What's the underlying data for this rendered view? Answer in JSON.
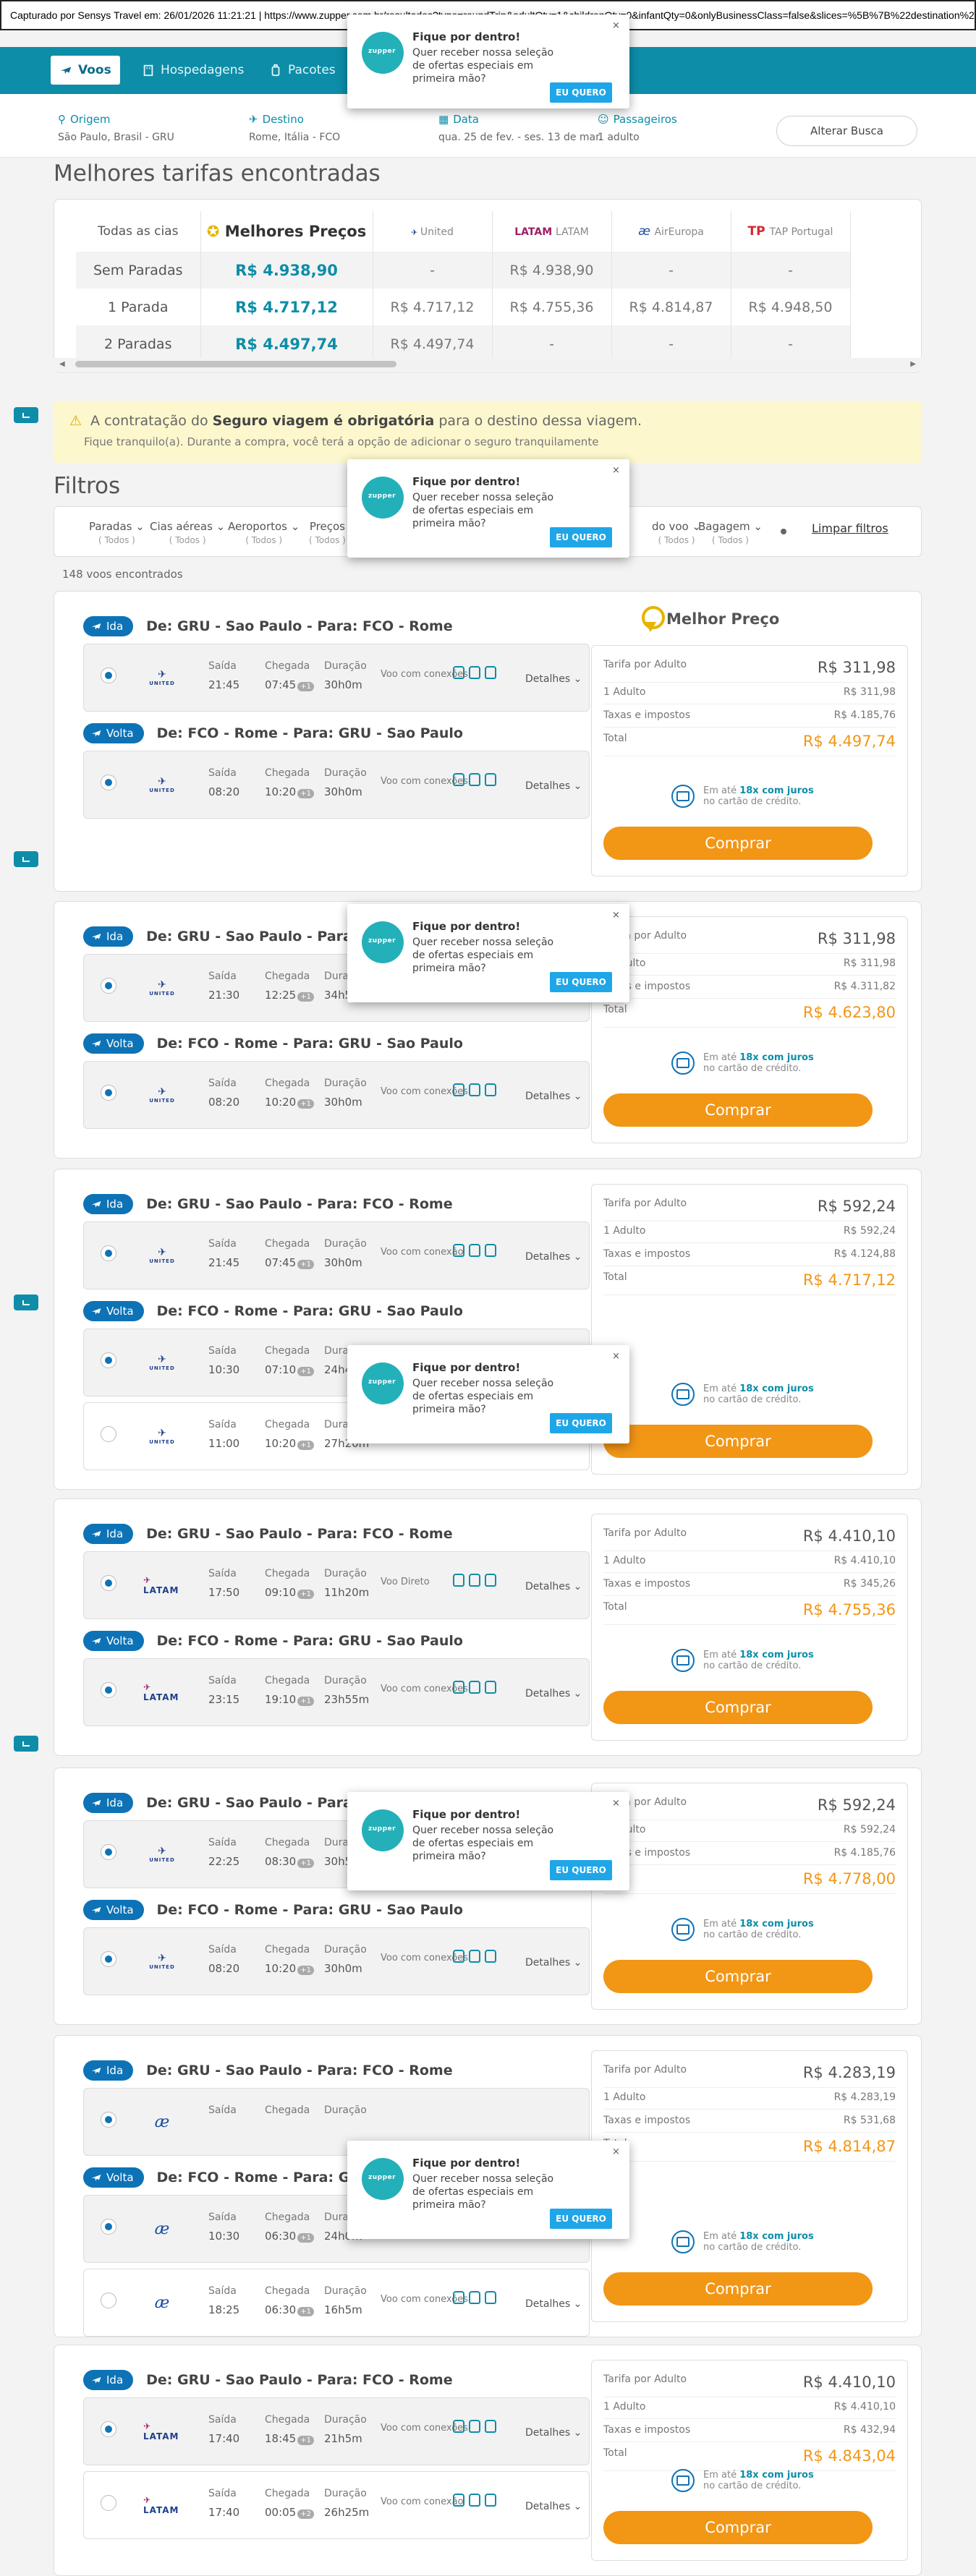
{
  "capture_bar": "Capturado por Sensys Travel em: 26/01/2026 11:21:21  |  https://www.zupper.com.br/resultados?type=roundTrip&adultQty=1&childrenQty=0&infantQty=0&onlyBusinessClass=false&slices=%5B%7B%22destination%22%3A%22FCO%22",
  "nav": {
    "voos": "Voos",
    "hospedagens": "Hospedagens",
    "pacotes": "Pacotes"
  },
  "search": {
    "origem_label": "Origem",
    "origem_value": "São Paulo, Brasil - GRU",
    "destino_label": "Destino",
    "destino_value": "Rome, Itália - FCO",
    "data_label": "Data",
    "data_value": "qua. 25 de fev. - ses. 13 de mar.",
    "pass_label": "Passageiros",
    "pass_value": "1 adulto",
    "alter": "Alterar Busca"
  },
  "fares": {
    "title": "Melhores tarifas encontradas",
    "col_all": "Todas as cias",
    "col_best": "Melhores Preços",
    "airlines": [
      "United",
      "LATAM",
      "AirEuropa",
      "TAP Portugal"
    ],
    "rows": [
      {
        "label": "Sem Paradas",
        "best": "R$ 4.938,90",
        "cells": [
          "-",
          "R$ 4.938,90",
          "-",
          "-"
        ]
      },
      {
        "label": "1 Parada",
        "best": "R$ 4.717,12",
        "cells": [
          "R$ 4.717,12",
          "R$ 4.755,36",
          "R$ 4.814,87",
          "R$ 4.948,50"
        ]
      },
      {
        "label": "2 Paradas",
        "best": "R$ 4.497,74",
        "cells": [
          "R$ 4.497,74",
          "-",
          "-",
          "-"
        ]
      }
    ]
  },
  "warning": {
    "pre": "A contratação do ",
    "bold": "Seguro viagem é obrigatória",
    "post": " para o destino dessa viagem.",
    "sub": "Fique tranquilo(a). Durante a compra, você terá a opção de adicionar o seguro tranquilamente"
  },
  "filters": {
    "title": "Filtros",
    "items": [
      {
        "label": "Paradas",
        "sub": "( Todos )"
      },
      {
        "label": "Cias aéreas",
        "sub": "( Todos )"
      },
      {
        "label": "Aeroportos",
        "sub": "( Todos )"
      },
      {
        "label": "Preços",
        "sub": "( Todos )"
      },
      {
        "label": "do voo",
        "sub": "( Todos )"
      },
      {
        "label": "Bagagem",
        "sub": "( Todos )"
      }
    ],
    "clear": "Limpar filtros",
    "count": "148 voos encontrados"
  },
  "popup": {
    "title": "Fique por dentro!",
    "text": "Quer receber nossa seleção de ofertas especiais em primeira mão?",
    "button": "EU QUERO",
    "close": "×"
  },
  "labels": {
    "ida": "Ida",
    "volta": "Volta",
    "saida": "Saída",
    "chegada": "Chegada",
    "duracao": "Duração",
    "com_conexoes": "Voo com conexões",
    "com_conexao": "Voo com conexão",
    "direto": "Voo Direto",
    "detalhes": "Detalhes",
    "tarifa": "Tarifa por Adulto",
    "adulto": "1 Adulto",
    "taxas": "Taxas e impostos",
    "total": "Total",
    "em_ate": "Em até ",
    "juros": "18x com juros",
    "cartao": "no cartão de crédito.",
    "comprar": "Comprar",
    "melhor_preco": "Melhor Preço",
    "route_ida": "De: GRU - Sao Paulo  -  Para: FCO - Rome",
    "route_volta": "De: FCO - Rome  -  Para: GRU - Sao Paulo"
  },
  "cards": [
    {
      "ida": [
        {
          "airline": "united",
          "sel": true,
          "dep": "21:45",
          "arr": "07:45",
          "plus": "+1",
          "dur": "30h0m",
          "conn": "com_conexoes"
        }
      ],
      "volta": [
        {
          "airline": "united",
          "sel": true,
          "dep": "08:20",
          "arr": "10:20",
          "plus": "+1",
          "dur": "30h0m",
          "conn": "com_conexoes"
        }
      ],
      "price": {
        "tarifa": "R$ 311,98",
        "adulto": "R$ 311,98",
        "taxas": "R$ 4.185,76",
        "total": "R$ 4.497,74"
      }
    },
    {
      "ida": [
        {
          "airline": "united",
          "sel": true,
          "dep": "21:30",
          "arr": "12:25",
          "plus": "+1",
          "dur": "34h55m",
          "conn": "com_conexoes"
        }
      ],
      "volta": [
        {
          "airline": "united",
          "sel": true,
          "dep": "08:20",
          "arr": "10:20",
          "plus": "+1",
          "dur": "30h0m",
          "conn": "com_conexoes"
        }
      ],
      "price": {
        "tarifa": "R$ 311,98",
        "adulto": "R$ 311,98",
        "taxas": "R$ 4.311,82",
        "total": "R$ 4.623,80"
      }
    },
    {
      "ida": [
        {
          "airline": "united",
          "sel": true,
          "dep": "21:45",
          "arr": "07:45",
          "plus": "+1",
          "dur": "30h0m",
          "conn": "com_conexao"
        }
      ],
      "volta": [
        {
          "airline": "united",
          "sel": true,
          "dep": "10:30",
          "arr": "07:10",
          "plus": "+1",
          "dur": "24h40m",
          "conn": "com_conexao"
        },
        {
          "airline": "united",
          "sel": false,
          "dep": "11:00",
          "arr": "10:20",
          "plus": "+1",
          "dur": "27h20m",
          "conn": "com_conexao"
        }
      ],
      "price": {
        "tarifa": "R$ 592,24",
        "adulto": "R$ 592,24",
        "taxas": "R$ 4.124,88",
        "total": "R$ 4.717,12"
      }
    },
    {
      "ida": [
        {
          "airline": "latam",
          "sel": true,
          "dep": "17:50",
          "arr": "09:10",
          "plus": "+1",
          "dur": "11h20m",
          "conn": "direto"
        }
      ],
      "volta": [
        {
          "airline": "latam",
          "sel": true,
          "dep": "23:15",
          "arr": "19:10",
          "plus": "+1",
          "dur": "23h55m",
          "conn": "com_conexoes"
        }
      ],
      "price": {
        "tarifa": "R$ 4.410,10",
        "adulto": "R$ 4.410,10",
        "taxas": "R$ 345,26",
        "total": "R$ 4.755,36"
      }
    },
    {
      "ida": [
        {
          "airline": "united",
          "sel": true,
          "dep": "22:25",
          "arr": "08:30",
          "plus": "+1",
          "dur": "30h5m",
          "conn": "com_conexoes"
        }
      ],
      "volta": [
        {
          "airline": "united",
          "sel": true,
          "dep": "08:20",
          "arr": "10:20",
          "plus": "+1",
          "dur": "30h0m",
          "conn": "com_conexoes"
        }
      ],
      "price": {
        "tarifa": "R$ 592,24",
        "adulto": "R$ 592,24",
        "taxas": "R$ 4.185,76",
        "total": "R$ 4.778,00"
      }
    },
    {
      "ida": [
        {
          "airline": "aireuropa",
          "sel": true,
          "dep": "",
          "arr": "",
          "plus": "",
          "dur": "",
          "conn": ""
        }
      ],
      "volta": [
        {
          "airline": "aireuropa",
          "sel": true,
          "dep": "10:30",
          "arr": "06:30",
          "plus": "+1",
          "dur": "24h0m",
          "conn": "com_conexoes"
        },
        {
          "airline": "aireuropa",
          "sel": false,
          "dep": "18:25",
          "arr": "06:30",
          "plus": "+1",
          "dur": "16h5m",
          "conn": "com_conexoes"
        }
      ],
      "price": {
        "tarifa": "R$ 4.283,19",
        "adulto": "R$ 4.283,19",
        "taxas": "R$ 531,68",
        "total": "R$ 4.814,87"
      }
    },
    {
      "ida": [
        {
          "airline": "latam",
          "sel": true,
          "dep": "17:40",
          "arr": "18:45",
          "plus": "+1",
          "dur": "21h5m",
          "conn": "com_conexoes"
        },
        {
          "airline": "latam",
          "sel": false,
          "dep": "17:40",
          "arr": "00:05",
          "plus": "+2",
          "dur": "26h25m",
          "conn": "com_conexao"
        }
      ],
      "volta": [],
      "price": {
        "tarifa": "R$ 4.410,10",
        "adulto": "R$ 4.410,10",
        "taxas": "R$ 432,94",
        "total": "R$ 4.843,04"
      }
    }
  ],
  "colors": {
    "teal": "#0d8da8",
    "blue": "#0d73b6",
    "orange": "#f29616"
  }
}
